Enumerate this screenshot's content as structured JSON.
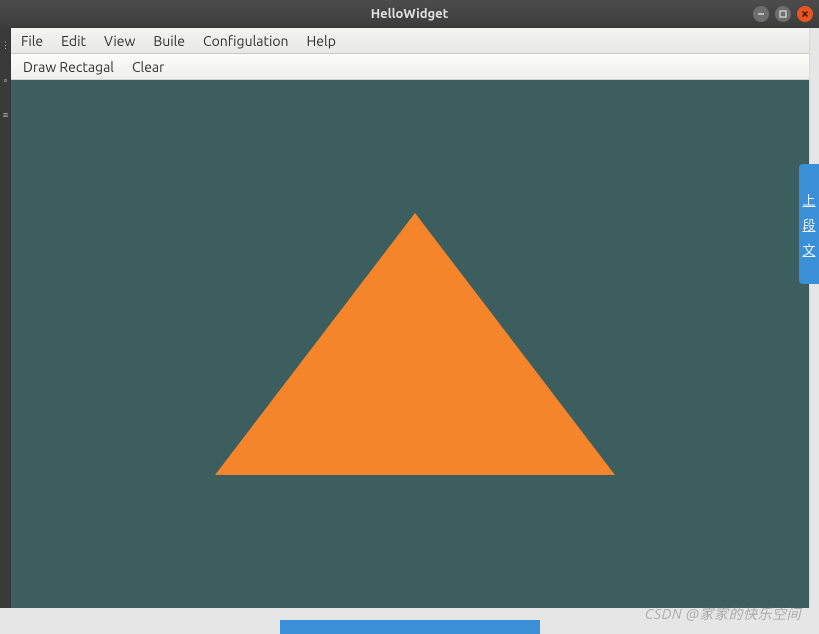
{
  "title": "HelloWidget",
  "menubar": {
    "items": [
      {
        "label": "File"
      },
      {
        "label": "Edit"
      },
      {
        "label": "View"
      },
      {
        "label": "Buile"
      },
      {
        "label": "Configulation"
      },
      {
        "label": "Help"
      }
    ]
  },
  "toolbar": {
    "draw_label": "Draw Rectagal",
    "clear_label": "Clear"
  },
  "canvas": {
    "shape": "triangle",
    "fill_color": "#f5852b",
    "background_color": "#3d5e5e"
  },
  "right_tab": {
    "chars": [
      "上",
      "段",
      "文"
    ]
  },
  "watermark": "CSDN @家家的快乐空间"
}
